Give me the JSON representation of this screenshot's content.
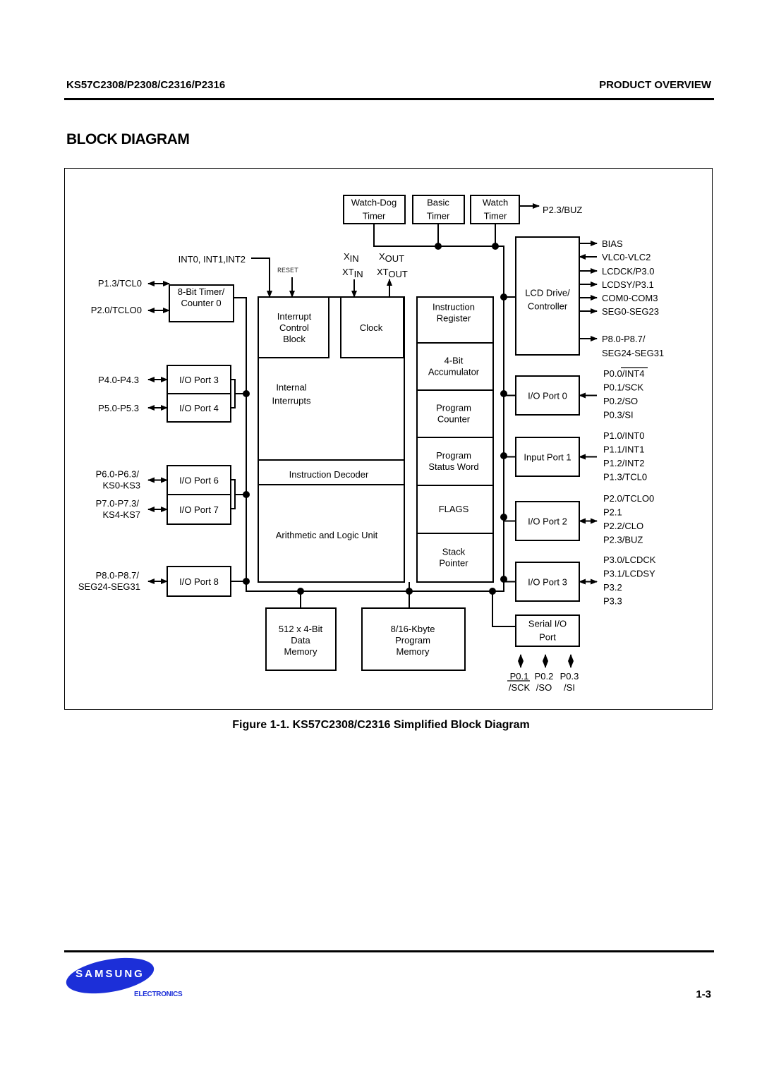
{
  "header": {
    "part_numbers": "KS57C2308/P2308/C2316/P2316",
    "section": "PRODUCT OVERVIEW"
  },
  "page_title": "BLOCK DIAGRAM",
  "diagram": {
    "timers": {
      "watchdog": [
        "Watch-Dog",
        "Timer"
      ],
      "basic": [
        "Basic",
        "Timer"
      ],
      "watch": [
        "Watch",
        "Timer"
      ],
      "watch_output": "P2.3/BUZ"
    },
    "interrupt_inputs": "INT0, INT1,INT2",
    "reset_label": "RESET",
    "clock_pins": {
      "xin": "X",
      "xin_sub": "IN",
      "xout": "X",
      "xout_sub": "OUT",
      "xtin": "XT",
      "xtin_sub": "IN",
      "xtout": "XT",
      "xtout_sub": "OUT"
    },
    "timer_counter": {
      "label": [
        "8-Bit Timer/",
        "Counter 0"
      ],
      "pins": [
        "P1.3/TCL0",
        "P2.0/TCLO0"
      ]
    },
    "cpu": {
      "interrupt_control": [
        "Interrupt",
        "Control",
        "Block"
      ],
      "clock": "Clock",
      "internal_interrupts": [
        "Internal",
        "Interrupts"
      ],
      "instruction_decoder": "Instruction Decoder",
      "alu": "Arithmetic and Logic Unit",
      "registers": [
        [
          "Instruction",
          "Register"
        ],
        [
          "4-Bit",
          "Accumulator"
        ],
        [
          "Program",
          "Counter"
        ],
        [
          "Program",
          "Status Word"
        ],
        [
          "FLAGS"
        ],
        [
          "Stack",
          "Pointer"
        ]
      ]
    },
    "left_ports": [
      {
        "label": "I/O Port 3",
        "pins": [
          "P4.0-P4.3"
        ]
      },
      {
        "label": "I/O Port 4",
        "pins": [
          "P5.0-P5.3"
        ]
      },
      {
        "label": "I/O Port 6",
        "pins": [
          "P6.0-P6.3/",
          "KS0-KS3"
        ]
      },
      {
        "label": "I/O Port 7",
        "pins": [
          "P7.0-P7.3/",
          "KS4-KS7"
        ]
      },
      {
        "label": "I/O Port 8",
        "pins": [
          "P8.0-P8.7/",
          "SEG24-SEG31"
        ]
      }
    ],
    "memories": {
      "data": [
        "512 x 4-Bit",
        "Data",
        "Memory"
      ],
      "program": [
        "8/16-Kbyte",
        "Program",
        "Memory"
      ]
    },
    "lcd": {
      "label": [
        "LCD Drive/",
        "Controller"
      ],
      "signals": [
        {
          "name": "BIAS",
          "dir": "out"
        },
        {
          "name": "VLC0-VLC2",
          "dir": "in"
        },
        {
          "name": "LCDCK/P3.0",
          "dir": "out"
        },
        {
          "name": "LCDSY/P3.1",
          "dir": "out"
        },
        {
          "name": "COM0-COM3",
          "dir": "out"
        },
        {
          "name": "SEG0-SEG23",
          "dir": "out"
        },
        {
          "name": "P8.0-P8.7/",
          "dir": "out"
        },
        {
          "name": "SEG24-SEG31",
          "dir": "none"
        }
      ]
    },
    "right_ports": [
      {
        "label": "I/O Port   0",
        "pins": [
          "P0.0/INT4",
          "P0.1/SCK",
          "P0.2/SO",
          "P0.3/SI"
        ],
        "dir": "in"
      },
      {
        "label": "Input Port 1",
        "pins": [
          "P1.0/INT0",
          "P1.1/INT1",
          "P1.2/INT2",
          "P1.3/TCL0"
        ],
        "dir": "in"
      },
      {
        "label": "I/O Port 2",
        "pins": [
          "P2.0/TCLO0",
          "P2.1",
          "P2.2/CLO",
          "P2.3/BUZ"
        ],
        "dir": "bi"
      },
      {
        "label": "I/O Port 3",
        "pins": [
          "P3.0/LCDCK",
          "P3.1/LCDSY",
          "P3.2",
          "P3.3"
        ],
        "dir": "bi"
      }
    ],
    "serial_io": {
      "label": [
        "Serial I/O",
        "Port"
      ],
      "pins": [
        [
          "P0.1",
          "/SCK"
        ],
        [
          "P0.2",
          "/SO"
        ],
        [
          "P0.3",
          "/SI"
        ]
      ]
    }
  },
  "caption": "Figure 1-1. KS57C2308/C2316 Simplified Block Diagram",
  "footer": {
    "logo_text": "SAMSUNG",
    "logo_sub": "ELECTRONICS",
    "page_number": "1-3",
    "brand_color": "#1c2fd8"
  }
}
